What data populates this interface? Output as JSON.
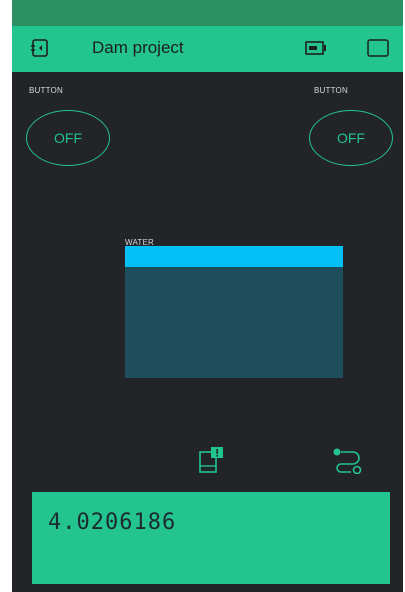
{
  "app": {
    "title": "Dam project"
  },
  "widgets": {
    "button_left": {
      "label": "BUTTON",
      "state": "OFF"
    },
    "button_right": {
      "label": "BUTTON",
      "state": "OFF"
    },
    "level": {
      "label": "WATER",
      "fill_fraction": 0.16
    },
    "value_display": {
      "value": "4.0206186"
    }
  },
  "icons": {
    "appbar_left": "device-return-icon",
    "appbar_battery": "battery-icon",
    "appbar_right": "square-icon",
    "bottom_left": "widget-box-icon",
    "bottom_right": "eventor-flow-icon"
  },
  "colors": {
    "accent": "#23c48e",
    "statusbar": "#2c8f62",
    "background": "#222428",
    "level_fill": "#04c0f8",
    "level_empty": "#1e4d5c"
  }
}
